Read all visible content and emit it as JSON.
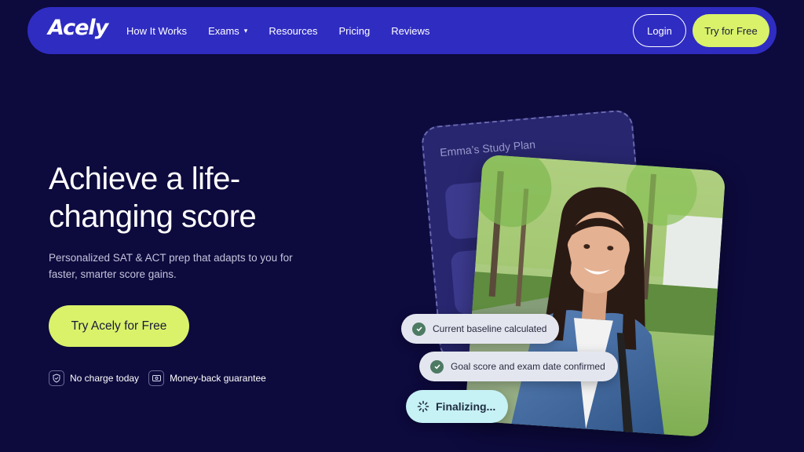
{
  "nav": {
    "logo": "Acely",
    "links": [
      {
        "label": "How It Works"
      },
      {
        "label": "Exams",
        "caret": "▾"
      },
      {
        "label": "Resources"
      },
      {
        "label": "Pricing"
      },
      {
        "label": "Reviews"
      }
    ],
    "login_label": "Login",
    "try_label": "Try for Free"
  },
  "hero": {
    "title": "Achieve a life-changing score",
    "subtitle": "Personalized SAT & ACT prep that adapts to you for faster, smarter score gains.",
    "cta_label": "Try Acely for Free",
    "badges": [
      {
        "icon": "shield-check-icon",
        "label": "No charge today"
      },
      {
        "icon": "money-icon",
        "label": "Money-back guarantee"
      }
    ]
  },
  "visual": {
    "plan_title": "Emma’s Study Plan",
    "steps": [
      {
        "label": "Current baseline calculated",
        "icon": "check-icon"
      },
      {
        "label": "Goal score and exam date confirmed",
        "icon": "check-icon"
      },
      {
        "label": "Finalizing...",
        "icon": "spinner-icon"
      }
    ]
  },
  "colors": {
    "background": "#0d0a3d",
    "nav": "#2f2cc2",
    "accent": "#d9f26a",
    "final_pill": "#c6f1f5"
  }
}
